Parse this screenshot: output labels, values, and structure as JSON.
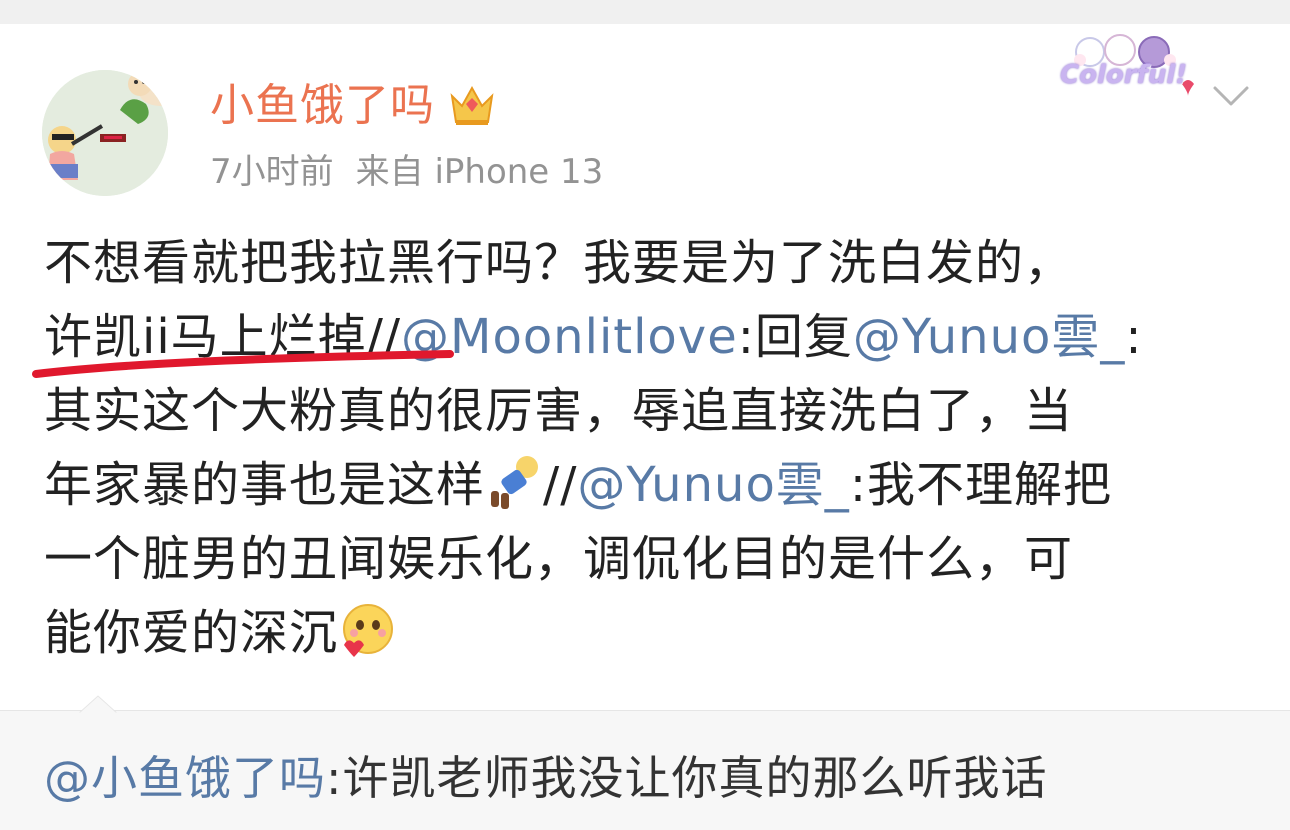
{
  "post": {
    "username": "小鱼饿了吗",
    "time": "7小时前",
    "source": "来自 iPhone 13",
    "badge_text": "Colorful!",
    "icons": {
      "crown": "vip-crown-icon",
      "menu": "chevron-down-icon",
      "emoji_doll": "doll-emoji-icon",
      "emoji_love": "heart-face-emoji-icon"
    },
    "lines": {
      "l1": "不想看就把我拉黑行吗？我要是为了洗白发的，",
      "l2_a": "许凯ii马上烂掉",
      "l2_b": "//",
      "l2_mention1": "@Moonlitlove",
      "l2_c": ":回复",
      "l2_mention2": "@Yunuo雲_",
      "l2_d": ":",
      "l3": "其实这个大粉真的很厉害，辱追直接洗白了，当",
      "l4_a": "年家暴的事也是这样",
      "l4_b": "//",
      "l4_mention": "@Yunuo雲_",
      "l4_c": ":我不理解把",
      "l5": "一个脏男的丑闻娱乐化，调侃化目的是什么，可",
      "l6": "能你爱的深沉"
    }
  },
  "comment": {
    "mention": "@小鱼饿了吗",
    "text": ":许凯老师我没让你真的那么听我话"
  },
  "colors": {
    "username": "#eb7350",
    "link": "#587aa6",
    "meta": "#939393",
    "text": "#222222",
    "annotation": "#e0182d"
  }
}
